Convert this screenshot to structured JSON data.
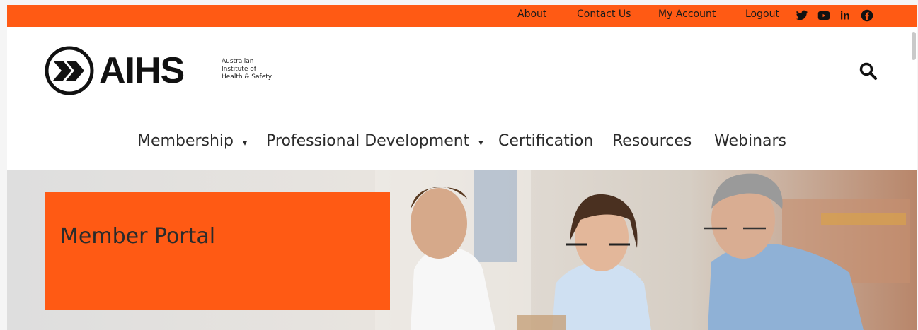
{
  "topbar": {
    "links": [
      "About",
      "Contact Us",
      "My Account",
      "Logout"
    ],
    "social_icons": [
      "twitter-icon",
      "youtube-icon",
      "linkedin-icon",
      "facebook-icon"
    ],
    "color": "#ff5a14"
  },
  "logo": {
    "wordmark": "AIHS",
    "line1": "Australian",
    "line2": "Institute of",
    "line3": "Health & Safety"
  },
  "nav": {
    "items": [
      {
        "label": "Membership",
        "dropdown": true
      },
      {
        "label": "Professional Development",
        "dropdown": true
      },
      {
        "label": "Certification",
        "dropdown": false
      },
      {
        "label": "Resources",
        "dropdown": false
      },
      {
        "label": "Webinars",
        "dropdown": false
      }
    ],
    "caret": "▾"
  },
  "hero": {
    "title": "Member Portal",
    "accent_color": "#ff5a14"
  }
}
